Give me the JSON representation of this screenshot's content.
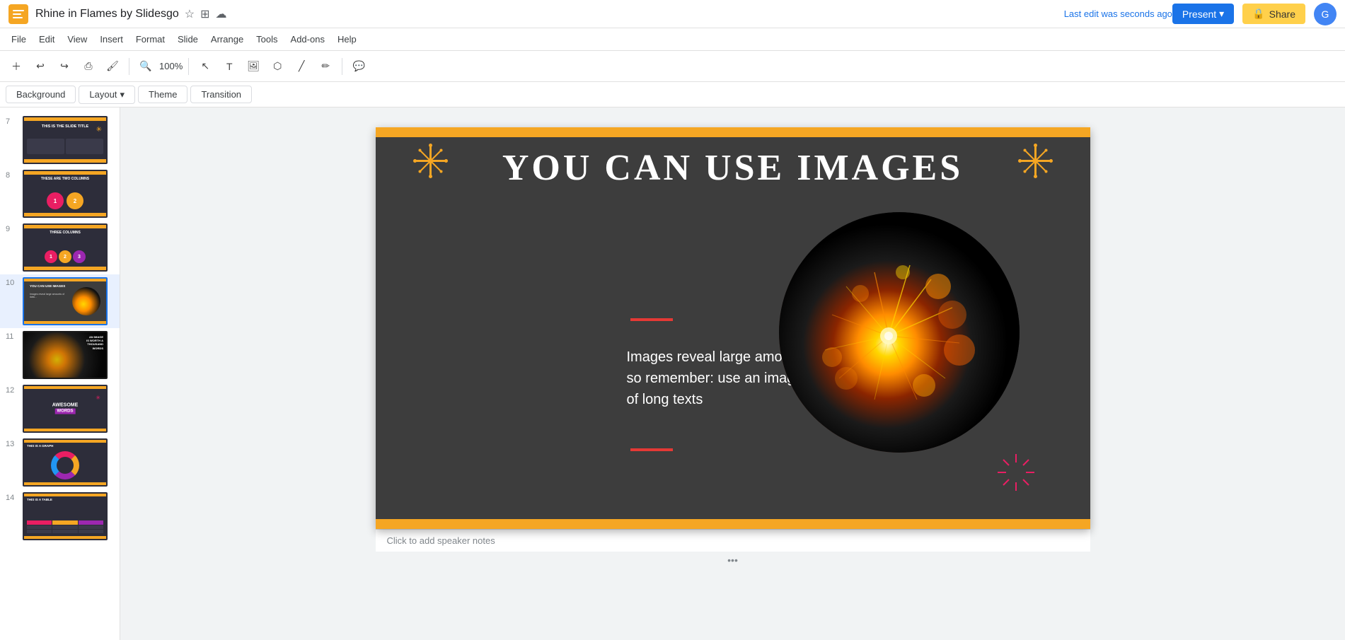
{
  "app": {
    "title": "Rhine in Flames by Slidesgo",
    "logo_color": "#f5a623"
  },
  "title_bar": {
    "title": "Rhine in Flames by Slidesgo",
    "last_edit": "Last edit was seconds ago",
    "present_label": "Present",
    "share_label": "Share",
    "share_icon": "🔒"
  },
  "menu": {
    "items": [
      "File",
      "Edit",
      "View",
      "Insert",
      "Format",
      "Slide",
      "Arrange",
      "Tools",
      "Add-ons",
      "Help"
    ]
  },
  "toolbar": {
    "zoom_label": "100%"
  },
  "format_bar": {
    "background_label": "Background",
    "layout_label": "Layout",
    "theme_label": "Theme",
    "transition_label": "Transition"
  },
  "slides": [
    {
      "number": "7",
      "label": "THIS IS THE SLIDE TITLE",
      "active": false
    },
    {
      "number": "8",
      "label": "THESE ARE TWO COLUMNS",
      "active": false
    },
    {
      "number": "9",
      "label": "THREE COLUMNS",
      "active": false
    },
    {
      "number": "10",
      "label": "YOU CAN USE IMAGES",
      "active": true
    },
    {
      "number": "11",
      "label": "AN IMAGE IS WORTH A THOUSAND WORDS",
      "active": false
    },
    {
      "number": "12",
      "label": "AWESOME Words",
      "active": false
    },
    {
      "number": "13",
      "label": "THIS IS A GRAPH",
      "active": false
    },
    {
      "number": "14",
      "label": "THIS IS A TABLE",
      "active": false
    }
  ],
  "current_slide": {
    "title": "YOU CAN USE IMAGES",
    "body": "Images reveal large amounts of data, so remember: use an image instead of long texts"
  },
  "speaker_notes": {
    "placeholder": "Click to add speaker notes"
  }
}
